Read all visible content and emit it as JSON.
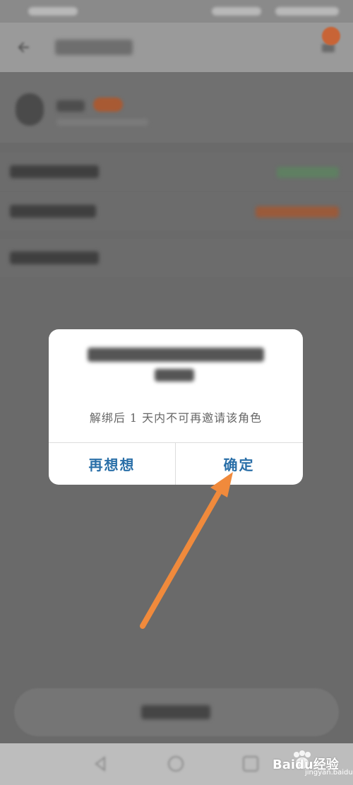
{
  "dialog": {
    "message": "解绑后 1 天内不可再邀请该角色",
    "cancel_label": "再想想",
    "confirm_label": "确定"
  },
  "watermark": {
    "brand": "Baidu经验",
    "url": "jingyan.baidu.com"
  },
  "colors": {
    "dialog_button": "#2a6fa8",
    "arrow": "#f08a3c",
    "overlay": "#6a6a6a"
  },
  "icons": [
    "back-icon",
    "nav-back-icon",
    "nav-home-icon",
    "nav-recent-icon"
  ]
}
